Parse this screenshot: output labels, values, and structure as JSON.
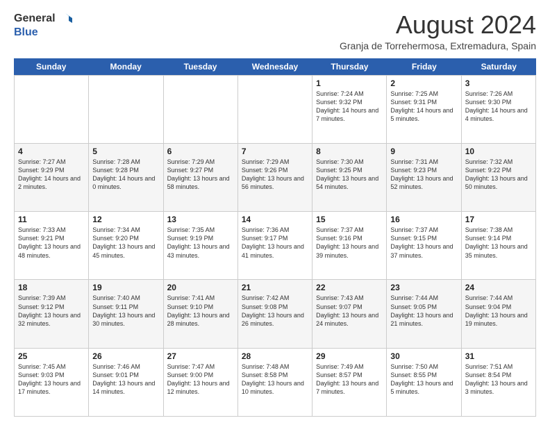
{
  "logo": {
    "line1": "General",
    "line2": "Blue"
  },
  "header": {
    "month_year": "August 2024",
    "location": "Granja de Torrehermosa, Extremadura, Spain"
  },
  "weekdays": [
    "Sunday",
    "Monday",
    "Tuesday",
    "Wednesday",
    "Thursday",
    "Friday",
    "Saturday"
  ],
  "rows": [
    {
      "alt": false,
      "cells": [
        {
          "day": "",
          "text": ""
        },
        {
          "day": "",
          "text": ""
        },
        {
          "day": "",
          "text": ""
        },
        {
          "day": "",
          "text": ""
        },
        {
          "day": "1",
          "text": "Sunrise: 7:24 AM\nSunset: 9:32 PM\nDaylight: 14 hours and 7 minutes."
        },
        {
          "day": "2",
          "text": "Sunrise: 7:25 AM\nSunset: 9:31 PM\nDaylight: 14 hours and 5 minutes."
        },
        {
          "day": "3",
          "text": "Sunrise: 7:26 AM\nSunset: 9:30 PM\nDaylight: 14 hours and 4 minutes."
        }
      ]
    },
    {
      "alt": true,
      "cells": [
        {
          "day": "4",
          "text": "Sunrise: 7:27 AM\nSunset: 9:29 PM\nDaylight: 14 hours and 2 minutes."
        },
        {
          "day": "5",
          "text": "Sunrise: 7:28 AM\nSunset: 9:28 PM\nDaylight: 14 hours and 0 minutes."
        },
        {
          "day": "6",
          "text": "Sunrise: 7:29 AM\nSunset: 9:27 PM\nDaylight: 13 hours and 58 minutes."
        },
        {
          "day": "7",
          "text": "Sunrise: 7:29 AM\nSunset: 9:26 PM\nDaylight: 13 hours and 56 minutes."
        },
        {
          "day": "8",
          "text": "Sunrise: 7:30 AM\nSunset: 9:25 PM\nDaylight: 13 hours and 54 minutes."
        },
        {
          "day": "9",
          "text": "Sunrise: 7:31 AM\nSunset: 9:23 PM\nDaylight: 13 hours and 52 minutes."
        },
        {
          "day": "10",
          "text": "Sunrise: 7:32 AM\nSunset: 9:22 PM\nDaylight: 13 hours and 50 minutes."
        }
      ]
    },
    {
      "alt": false,
      "cells": [
        {
          "day": "11",
          "text": "Sunrise: 7:33 AM\nSunset: 9:21 PM\nDaylight: 13 hours and 48 minutes."
        },
        {
          "day": "12",
          "text": "Sunrise: 7:34 AM\nSunset: 9:20 PM\nDaylight: 13 hours and 45 minutes."
        },
        {
          "day": "13",
          "text": "Sunrise: 7:35 AM\nSunset: 9:19 PM\nDaylight: 13 hours and 43 minutes."
        },
        {
          "day": "14",
          "text": "Sunrise: 7:36 AM\nSunset: 9:17 PM\nDaylight: 13 hours and 41 minutes."
        },
        {
          "day": "15",
          "text": "Sunrise: 7:37 AM\nSunset: 9:16 PM\nDaylight: 13 hours and 39 minutes."
        },
        {
          "day": "16",
          "text": "Sunrise: 7:37 AM\nSunset: 9:15 PM\nDaylight: 13 hours and 37 minutes."
        },
        {
          "day": "17",
          "text": "Sunrise: 7:38 AM\nSunset: 9:14 PM\nDaylight: 13 hours and 35 minutes."
        }
      ]
    },
    {
      "alt": true,
      "cells": [
        {
          "day": "18",
          "text": "Sunrise: 7:39 AM\nSunset: 9:12 PM\nDaylight: 13 hours and 32 minutes."
        },
        {
          "day": "19",
          "text": "Sunrise: 7:40 AM\nSunset: 9:11 PM\nDaylight: 13 hours and 30 minutes."
        },
        {
          "day": "20",
          "text": "Sunrise: 7:41 AM\nSunset: 9:10 PM\nDaylight: 13 hours and 28 minutes."
        },
        {
          "day": "21",
          "text": "Sunrise: 7:42 AM\nSunset: 9:08 PM\nDaylight: 13 hours and 26 minutes."
        },
        {
          "day": "22",
          "text": "Sunrise: 7:43 AM\nSunset: 9:07 PM\nDaylight: 13 hours and 24 minutes."
        },
        {
          "day": "23",
          "text": "Sunrise: 7:44 AM\nSunset: 9:05 PM\nDaylight: 13 hours and 21 minutes."
        },
        {
          "day": "24",
          "text": "Sunrise: 7:44 AM\nSunset: 9:04 PM\nDaylight: 13 hours and 19 minutes."
        }
      ]
    },
    {
      "alt": false,
      "cells": [
        {
          "day": "25",
          "text": "Sunrise: 7:45 AM\nSunset: 9:03 PM\nDaylight: 13 hours and 17 minutes."
        },
        {
          "day": "26",
          "text": "Sunrise: 7:46 AM\nSunset: 9:01 PM\nDaylight: 13 hours and 14 minutes."
        },
        {
          "day": "27",
          "text": "Sunrise: 7:47 AM\nSunset: 9:00 PM\nDaylight: 13 hours and 12 minutes."
        },
        {
          "day": "28",
          "text": "Sunrise: 7:48 AM\nSunset: 8:58 PM\nDaylight: 13 hours and 10 minutes."
        },
        {
          "day": "29",
          "text": "Sunrise: 7:49 AM\nSunset: 8:57 PM\nDaylight: 13 hours and 7 minutes."
        },
        {
          "day": "30",
          "text": "Sunrise: 7:50 AM\nSunset: 8:55 PM\nDaylight: 13 hours and 5 minutes."
        },
        {
          "day": "31",
          "text": "Sunrise: 7:51 AM\nSunset: 8:54 PM\nDaylight: 13 hours and 3 minutes."
        }
      ]
    }
  ]
}
